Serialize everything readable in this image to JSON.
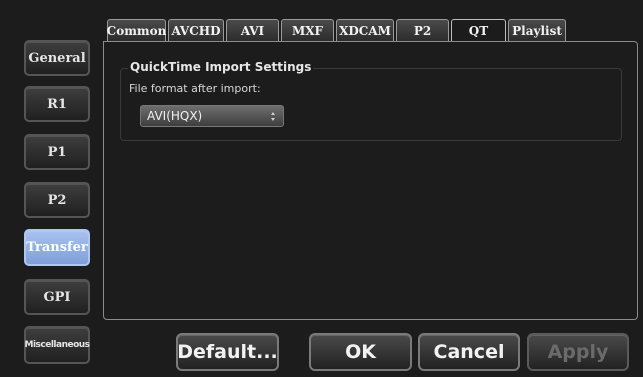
{
  "sidebar": {
    "items": [
      {
        "label": "General"
      },
      {
        "label": "R1"
      },
      {
        "label": "P1"
      },
      {
        "label": "P2"
      },
      {
        "label": "Transfer",
        "active": true
      },
      {
        "label": "GPI"
      },
      {
        "label": "Miscellaneous"
      }
    ]
  },
  "tabs": [
    {
      "label": "Common"
    },
    {
      "label": "AVCHD"
    },
    {
      "label": "AVI"
    },
    {
      "label": "MXF"
    },
    {
      "label": "XDCAM"
    },
    {
      "label": "P2"
    },
    {
      "label": "QT",
      "active": true
    },
    {
      "label": "Playlist"
    }
  ],
  "content": {
    "group_title": "QuickTime Import Settings",
    "format_label": "File format after import:",
    "format_value": "AVI(HQX)"
  },
  "buttons": {
    "default": "Default...",
    "ok": "OK",
    "cancel": "Cancel",
    "apply": "Apply"
  },
  "colors": {
    "background": "#1c1c1c",
    "active_sidebar": "#8fabe0",
    "disabled_text": "#6a6a6a"
  }
}
